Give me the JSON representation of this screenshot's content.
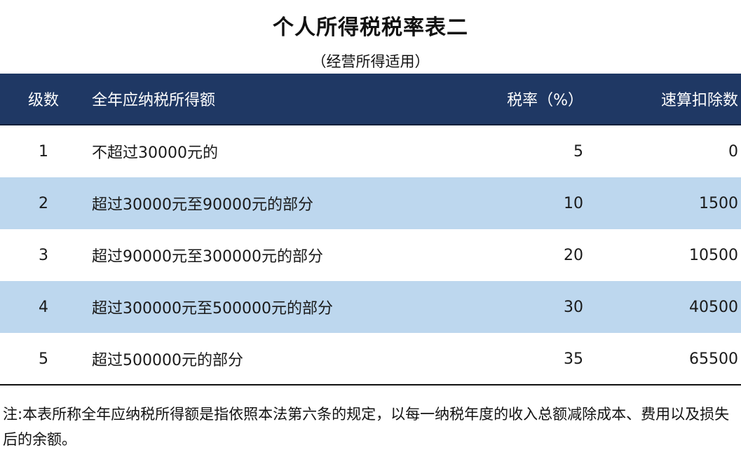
{
  "title": "个人所得税税率表二",
  "subtitle": "（经营所得适用）",
  "table": {
    "headers": {
      "level": "级数",
      "range": "全年应纳税所得额",
      "rate": "税率（%）",
      "deduction": "速算扣除数"
    },
    "rows": [
      {
        "level": "1",
        "range": "不超过30000元的",
        "rate": "5",
        "deduction": "0"
      },
      {
        "level": "2",
        "range": "超过30000元至90000元的部分",
        "rate": "10",
        "deduction": "1500"
      },
      {
        "level": "3",
        "range": "超过90000元至300000元的部分",
        "rate": "20",
        "deduction": "10500"
      },
      {
        "level": "4",
        "range": "超过300000元至500000元的部分",
        "rate": "30",
        "deduction": "40500"
      },
      {
        "level": "5",
        "range": "超过500000元的部分",
        "rate": "35",
        "deduction": "65500"
      }
    ]
  },
  "note": "注:本表所称全年应纳税所得额是指依照本法第六条的规定，以每一纳税年度的收入总额减除成本、费用以及损失后的余额。",
  "colors": {
    "header_bg": "#1f3864",
    "header_text": "#ffffff",
    "stripe": "#bdd7ee"
  }
}
